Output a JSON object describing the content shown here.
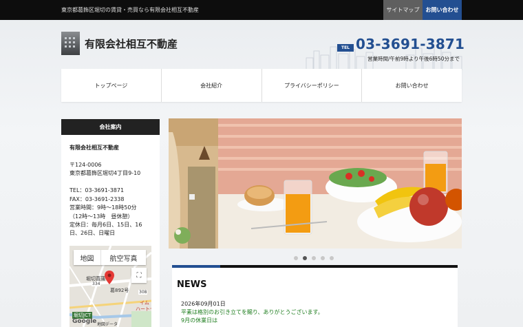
{
  "topbar": {
    "tagline": "東京都葛飾区堀切の賃貸・売買なら有限会社相互不動産",
    "sitemap_label": "サイトマップ",
    "contact_label": "お問い合わせ"
  },
  "header": {
    "site_title": "有限会社相互不動産",
    "tel_badge": "TEL",
    "tel_number": "03-3691-3871",
    "hours": "営業時間/午前9時より午後6時50分まで"
  },
  "nav": {
    "items": [
      {
        "label": "トップページ"
      },
      {
        "label": "会社紹介"
      },
      {
        "label": "プライバシーポリシー"
      },
      {
        "label": "お問い合わせ"
      }
    ]
  },
  "sidebar": {
    "title": "会社案内",
    "company": "有限会社相互不動産",
    "postal": "〒124-0006",
    "address": "東京都葛飾区堀切4丁目9-10",
    "tel": "TEL：03-3691-3871",
    "fax": "FAX：03-3691-2338",
    "hours": "営業時間：9時～18時50分",
    "lunch": "（12時～13時　昼休憩）",
    "closed_1": "定休日：毎月6日、15日、16",
    "closed_2": "日、26日、日曜日"
  },
  "map": {
    "tab_map": "地図",
    "tab_satellite": "航空写真",
    "fullscreen_icon": "fullscreen-icon",
    "labels": {
      "station": "堀切菖蒲",
      "route_334": "334",
      "route_308": "308",
      "bridge": "葛892号",
      "store": "イム",
      "store2": "ハートセ",
      "jct": "堀切JCT",
      "google": "Google",
      "map_data": "地図データ"
    }
  },
  "slideshow": {
    "slide_count": 5,
    "active_index": 1
  },
  "news": {
    "title": "NEWS",
    "date": "2026年09月01日",
    "line1": "平素は格別のお引き立てを賜り、ありがとうございます。",
    "line2": "9月の休業日は"
  },
  "colors": {
    "brand_blue": "#234f91",
    "news_green": "#1e7d1e",
    "topbar_bg": "#0d0d0d",
    "sidebar_header": "#222222"
  }
}
